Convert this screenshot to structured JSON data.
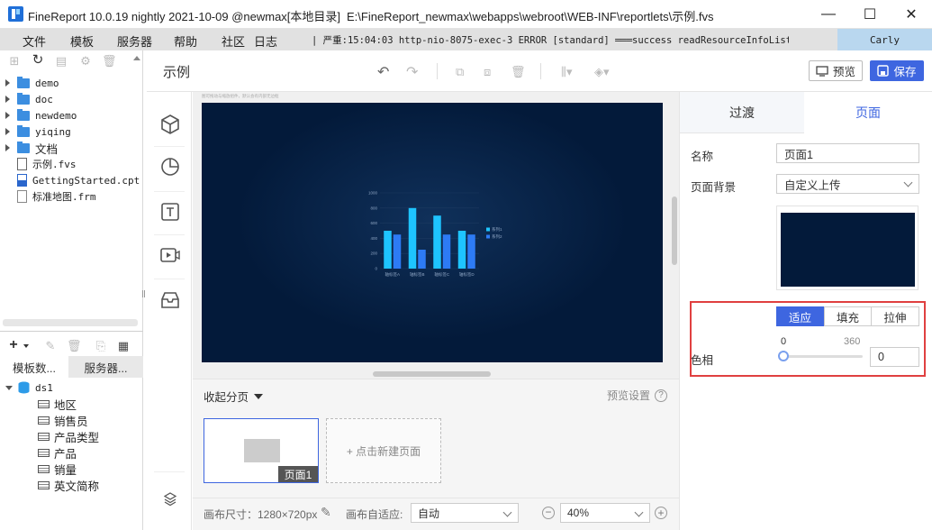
{
  "titlebar": {
    "app_title": "FineReport 10.0.19 nightly 2021-10-09 @newmax[本地目录]",
    "file_path": "E:\\FineReport_newmax\\webapps\\webroot\\WEB-INF\\reportlets\\示例.fvs",
    "minimize": "—",
    "maximize": "☐",
    "close": "✕"
  },
  "menubar": {
    "items": [
      "文件",
      "模板",
      "服务器",
      "帮助",
      "社区"
    ],
    "log_label": "日志",
    "log_text": "| 严重:15:04:03 http-nio-8075-exec-3 ERROR [standard] ═══success readResourceInfoList: rep...",
    "user": "Carly"
  },
  "filetree": {
    "items": [
      {
        "type": "folder",
        "label": "demo"
      },
      {
        "type": "folder",
        "label": "doc"
      },
      {
        "type": "folder",
        "label": "newdemo"
      },
      {
        "type": "folder",
        "label": "yiqing"
      },
      {
        "type": "folder",
        "label": "文档"
      },
      {
        "type": "file",
        "label": "示例.fvs"
      },
      {
        "type": "file",
        "label": "GettingStarted.cpt"
      },
      {
        "type": "file",
        "label": "标准地图.frm"
      }
    ]
  },
  "datapanel": {
    "tabs": [
      "模板数...",
      "服务器..."
    ],
    "dataset": "ds1",
    "fields": [
      "地区",
      "销售员",
      "产品类型",
      "产品",
      "销量",
      "英文简称"
    ]
  },
  "editor": {
    "title": "示例",
    "preview_button": "预览",
    "save_button": "保存",
    "canvas_caption": "图可拖动与缩放组件，默认会有内部无边框"
  },
  "chart_data": {
    "type": "bar",
    "categories": [
      "轴标签A",
      "轴标签B",
      "轴标签C",
      "轴标签D"
    ],
    "series": [
      {
        "name": "系列1",
        "values": [
          500,
          800,
          700,
          500
        ]
      },
      {
        "name": "系列2",
        "values": [
          450,
          250,
          450,
          450
        ]
      }
    ],
    "yticks": [
      "1000",
      "800",
      "600",
      "400",
      "200",
      "0"
    ],
    "ylim": [
      0,
      1000
    ],
    "colors": [
      "#1ec4ff",
      "#2d7bf5"
    ],
    "legend_position": "right"
  },
  "pages": {
    "collapse_label": "收起分页",
    "settings_label": "预览设置",
    "page_label": "页面1",
    "new_page_label": "+ 点击新建页面"
  },
  "bottombar": {
    "canvas_size": "画布尺寸：1280×720px",
    "adapt_label": "画布自适应:",
    "adapt_value": "自动",
    "zoom_value": "40%"
  },
  "rightpanel": {
    "tabs": [
      "过渡",
      "页面"
    ],
    "name_label": "名称",
    "name_value": "页面1",
    "bg_label": "页面背景",
    "bg_value": "自定义上传",
    "fit_options": [
      "适应",
      "填充",
      "拉伸"
    ],
    "hue_label": "色相",
    "hue_min": "0",
    "hue_max": "360",
    "hue_value": "0"
  }
}
